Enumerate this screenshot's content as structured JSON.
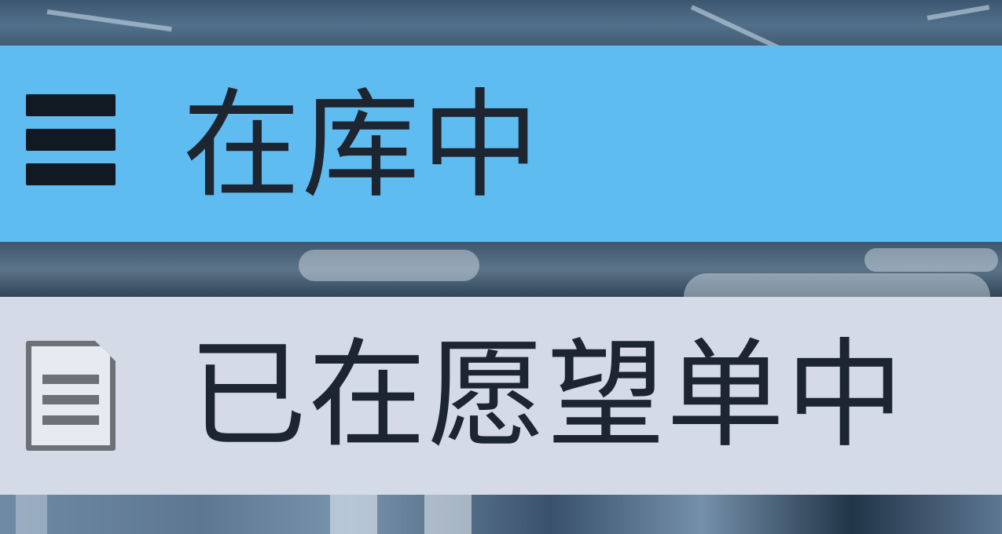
{
  "menu": {
    "items": [
      {
        "label": "在库中",
        "icon": "stack-icon",
        "selected": true
      },
      {
        "label": "已在愿望单中",
        "icon": "document-icon",
        "selected": false
      }
    ]
  },
  "colors": {
    "selected_bg": "#5fbcf0",
    "item_bg": "#d4dbe7",
    "text": "#1c2530"
  }
}
